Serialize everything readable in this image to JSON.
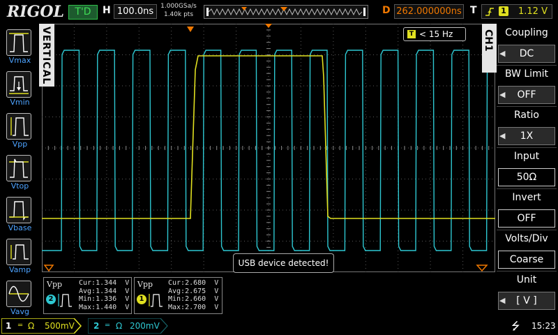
{
  "brand": "RIGOL",
  "top": {
    "run_status": "T'D",
    "horizontal_label": "H",
    "timebase": "100.0ns",
    "sample_rate": "1.000GSa/s",
    "mem_depth": "1.40k pts",
    "delay_label": "D",
    "delay_value": "262.000000ns",
    "trigger_label": "T",
    "trigger_source": "1",
    "trigger_level": "1.12 V"
  },
  "colors": {
    "ch1": "#e0e020",
    "ch2": "#2ec8d2",
    "accent_orange": "#f07800",
    "menu_blue": "#4da3ff",
    "grid": "#5a5a5a"
  },
  "left_menu": {
    "side_tab": "VERTICAL",
    "items": [
      {
        "label": "Vmax",
        "icon": "vmax-icon"
      },
      {
        "label": "Vmin",
        "icon": "vmin-icon"
      },
      {
        "label": "Vpp",
        "icon": "vpp-icon"
      },
      {
        "label": "Vtop",
        "icon": "vtop-icon"
      },
      {
        "label": "Vbase",
        "icon": "vbase-icon"
      },
      {
        "label": "Vamp",
        "icon": "vamp-icon"
      },
      {
        "label": "Vavg",
        "icon": "vavg-icon"
      }
    ]
  },
  "right_menu": {
    "side_tab": "CH1",
    "items": [
      {
        "title": "Coupling",
        "value": "DC"
      },
      {
        "title": "BW Limit",
        "value": "OFF"
      },
      {
        "title": "Ratio",
        "value": "1X"
      },
      {
        "title": "Input",
        "value": "50Ω"
      },
      {
        "title": "Invert",
        "value": "OFF"
      },
      {
        "title": "Volts/Div",
        "value": "Coarse"
      },
      {
        "title": "Unit",
        "value": "[  V  ]"
      }
    ]
  },
  "trigger_frequency": "< 15 Hz",
  "notification": "USB device detected!",
  "measurements": [
    {
      "channel": "2",
      "name": "Vpp",
      "cur": "Cur:1.344  V",
      "avg": "Avg:1.344  V",
      "min": "Min:1.336  V",
      "max": "Max:1.440  V"
    },
    {
      "channel": "1",
      "name": "Vpp",
      "cur": "Cur:2.680  V",
      "avg": "Avg:2.675  V",
      "min": "Min:2.660  V",
      "max": "Max:2.700  V"
    }
  ],
  "bottom": {
    "ch1_num": "1",
    "ch1_scale": "500mV",
    "ch2_num": "2",
    "ch2_scale": "200mV",
    "time": "15:23"
  }
}
